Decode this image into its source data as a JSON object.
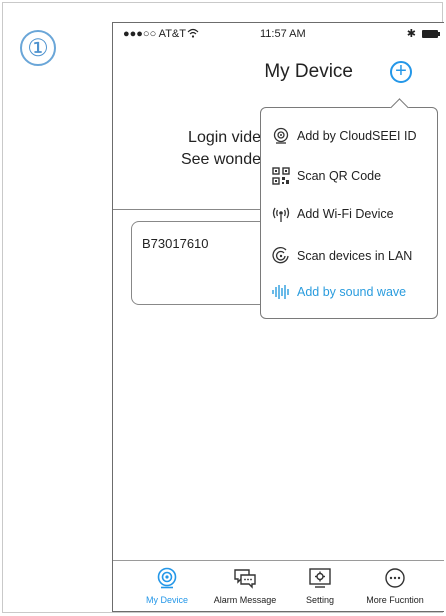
{
  "step": {
    "number": "①"
  },
  "status_bar": {
    "carrier": "●●●○○ AT&T",
    "time": "11:57 AM"
  },
  "header": {
    "title": "My Device"
  },
  "empty_state": {
    "line1": "Login vide",
    "line2": "See wonde"
  },
  "devices": [
    {
      "id": "B73017610"
    }
  ],
  "popup_menu": {
    "items": [
      {
        "label": "Add by CloudSEEI ID",
        "icon": "camera-icon"
      },
      {
        "label": "Scan QR Code",
        "icon": "qr-code-icon"
      },
      {
        "label": "Add Wi-Fi Device",
        "icon": "wifi-device-icon"
      },
      {
        "label": "Scan devices in LAN",
        "icon": "lan-scan-icon"
      },
      {
        "label": "Add by sound wave",
        "icon": "sound-wave-icon",
        "highlighted": true
      }
    ]
  },
  "tabs": [
    {
      "label": "My Device",
      "icon": "camera-icon",
      "active": true
    },
    {
      "label": "Alarm Message",
      "icon": "message-icon"
    },
    {
      "label": "Setting",
      "icon": "settings-icon"
    },
    {
      "label": "More Fucntion",
      "icon": "more-icon"
    }
  ],
  "colors": {
    "accent": "#2497e8",
    "highlight": "#2a9cde",
    "step_number": "#4f93cf"
  }
}
